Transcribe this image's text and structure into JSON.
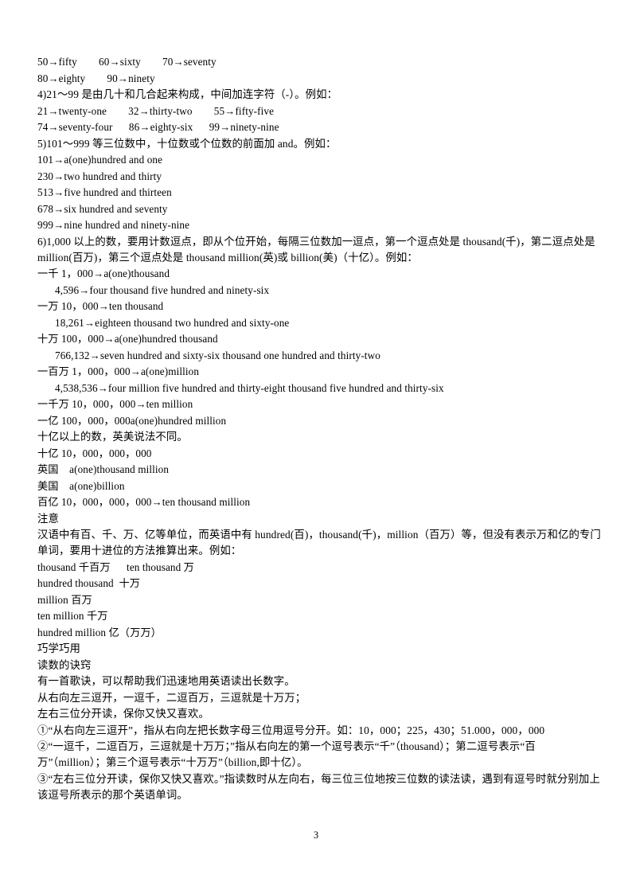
{
  "document": {
    "page_number": "3",
    "lines": [
      {
        "id": "l01",
        "text": "50→fifty        60→sixty        70→seventy"
      },
      {
        "id": "l02",
        "text": "80→eighty        90→ninety"
      },
      {
        "id": "l03",
        "text": "4)21～99 是由几十和几合起来构成，中间加连字符（-）。例如："
      },
      {
        "id": "l04",
        "text": "21→twenty-one        32→thirty-two        55→fifty-five"
      },
      {
        "id": "l05",
        "text": "74→seventy-four      86→eighty-six      99→ninety-nine"
      },
      {
        "id": "l06",
        "text": "5)101～999 等三位数中，十位数或个位数的前面加 and。例如："
      },
      {
        "id": "l07",
        "text": "101→a(one)hundred and one"
      },
      {
        "id": "l08",
        "text": "230→two hundred and thirty"
      },
      {
        "id": "l09",
        "text": "513→five hundred and thirteen"
      },
      {
        "id": "l10",
        "text": "678→six hundred and seventy"
      },
      {
        "id": "l11",
        "text": "999→nine hundred and ninety-nine"
      },
      {
        "id": "l12",
        "text": "6)1,000 以上的数，要用计数逗点，即从个位开始，每隔三位数加一逗点，第一个逗点处是 thousand(千)，第二逗点处是 million(百万)，第三个逗点处是 thousand million(英)或 billion(美)（十亿）。例如："
      },
      {
        "id": "l13",
        "text": "一千 1，000→a(one)thousand"
      },
      {
        "id": "l14",
        "text": "4,596→four thousand five hundred and ninety-six"
      },
      {
        "id": "l15",
        "text": "一万 10，000→ten thousand"
      },
      {
        "id": "l16",
        "text": "18,261→eighteen thousand two hundred and sixty-one"
      },
      {
        "id": "l17",
        "text": "十万 100，000→a(one)hundred thousand"
      },
      {
        "id": "l18",
        "text": "766,132→seven hundred and sixty-six thousand one hundred and thirty-two"
      },
      {
        "id": "l19",
        "text": "一百万 1，000，000→a(one)million"
      },
      {
        "id": "l20",
        "text": "4,538,536→four million five hundred and thirty-eight thousand five hundred and thirty-six"
      },
      {
        "id": "l21",
        "text": "一千万 10，000，000→ten million"
      },
      {
        "id": "l22",
        "text": "一亿 100，000，000a(one)hundred million"
      },
      {
        "id": "l23",
        "text": "十亿以上的数，英美说法不同。"
      },
      {
        "id": "l24",
        "text": "十亿 10，000，000，000"
      },
      {
        "id": "l25",
        "text": "英国    a(one)thousand million"
      },
      {
        "id": "l26",
        "text": "美国    a(one)billion"
      },
      {
        "id": "l27",
        "text": "百亿 10，000，000，000→ten thousand million"
      },
      {
        "id": "l28",
        "text": "注意"
      },
      {
        "id": "l29",
        "text": "汉语中有百、千、万、亿等单位，而英语中有 hundred(百)，thousand(千)，million（百万）等，但没有表示万和亿的专门单词，要用十进位的方法推算出来。例如："
      },
      {
        "id": "l30",
        "text": "thousand 千百万      ten thousand 万"
      },
      {
        "id": "l31",
        "text": "hundred thousand  十万"
      },
      {
        "id": "l32",
        "text": "million 百万"
      },
      {
        "id": "l33",
        "text": "ten million 千万"
      },
      {
        "id": "l34",
        "text": "hundred million 亿（万万）"
      },
      {
        "id": "l35",
        "text": "巧学巧用"
      },
      {
        "id": "l36",
        "text": "读数的诀窍"
      },
      {
        "id": "l37",
        "text": "有一首歌诀，可以帮助我们迅速地用英语读出长数字。"
      },
      {
        "id": "l38",
        "text": "从右向左三逗开，一逗千，二逗百万，三逗就是十万万；"
      },
      {
        "id": "l39",
        "text": "左右三位分开读，保你又快又喜欢。"
      },
      {
        "id": "l40",
        "text": "①“从右向左三逗开”，指从右向左把长数字母三位用逗号分开。如：10，000；225，430；51.000，000，000"
      },
      {
        "id": "l41",
        "text": "②“一逗千，二逗百万，三逗就是十万万；”指从右向左的第一个逗号表示“千”（thousand）；第二逗号表示“百万”（million）；第三个逗号表示“十万万”（billion,即十亿）。"
      },
      {
        "id": "l42",
        "text": "③“左右三位分开读，保你又快又喜欢。”指读数时从左向右，每三位三位地按三位数的读法读，遇到有逗号时就分别加上该逗号所表示的那个英语单词。"
      }
    ]
  }
}
